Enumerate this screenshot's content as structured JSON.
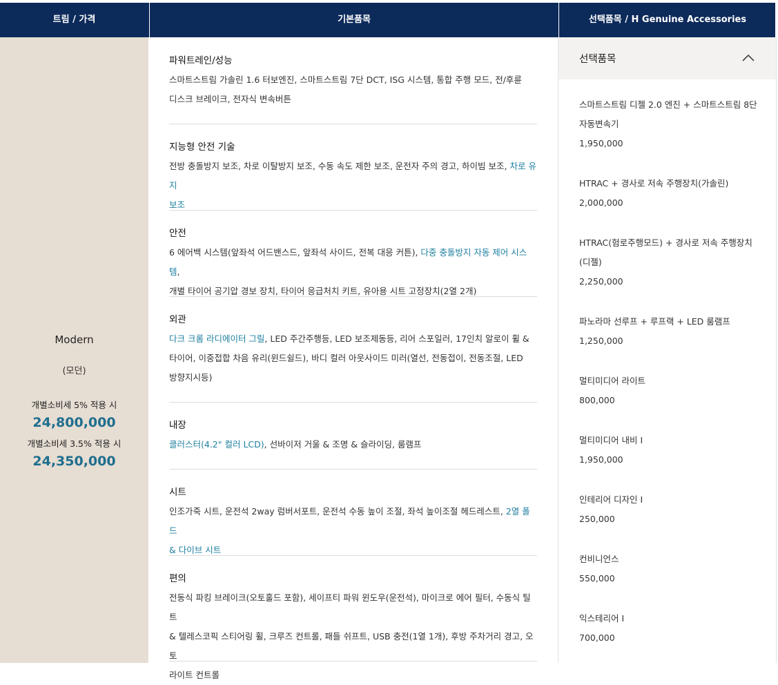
{
  "header": {
    "trim_price": "트림 / 가격",
    "base_items": "기본품목",
    "options": "선택품목 / H Genuine Accessories"
  },
  "trim": {
    "name": "Modern",
    "sub": "(모던)",
    "prices": [
      {
        "label": "개별소비세 5% 적용 시",
        "value": "24,800,000"
      },
      {
        "label": "개별소비세 3.5% 적용 시",
        "value": "24,350,000"
      }
    ]
  },
  "sections": [
    {
      "title": "파워트레인/성능",
      "lines": [
        [
          {
            "t": "스마트스트림 가솔린 1.6 터보엔진, 스마트스트림 7단 DCT, ISG 시스템, 통합 주행 모드, 전/후륜"
          }
        ],
        [
          {
            "t": "디스크 브레이크, 전자식 변속버튼"
          }
        ]
      ]
    },
    {
      "title": "지능형 안전 기술",
      "lines": [
        [
          {
            "t": "전방 충돌방지 보조, 차로 이탈방지 보조, 수동 속도 제한 보조, 운전자 주의 경고, 하이빔 보조, "
          },
          {
            "t": "차로 유지",
            "hl": true
          }
        ],
        [
          {
            "t": "보조",
            "hl": true
          }
        ]
      ]
    },
    {
      "title": "안전",
      "lines": [
        [
          {
            "t": "6 에어백 시스템(앞좌석 어드밴스드, 앞좌석 사이드, 전복 대응 커튼), "
          },
          {
            "t": "다중 충돌방지 자동 제어 시스템",
            "hl": true
          },
          {
            "t": ","
          }
        ],
        [
          {
            "t": "개별 타이어 공기압 경보 장치, 타이어 응급처치 키트, 유아용 시트 고정장치(2열 2개)"
          }
        ]
      ]
    },
    {
      "title": "외관",
      "lines": [
        [
          {
            "t": "다크 크롬 라디에이터 그릴",
            "hl": true
          },
          {
            "t": ", LED 주간주행등, LED 보조제동등, 리어 스포일러, 17인치 알로이 휠 &"
          }
        ],
        [
          {
            "t": "타이어, 이중접합 차음 유리(윈드쉴드), 바디 컬러 아웃사이드 미러(열선, 전동접이, 전동조절, LED"
          }
        ],
        [
          {
            "t": "방향지시등)"
          }
        ]
      ]
    },
    {
      "title": "내장",
      "lines": [
        [
          {
            "t": "클러스터(4.2\" 컬러 LCD)",
            "hl": true
          },
          {
            "t": ", 선바이저 거울 & 조명 & 슬라이딩, 룸램프"
          }
        ]
      ]
    },
    {
      "title": "시트",
      "lines": [
        [
          {
            "t": "인조가죽 시트, 운전석 2way 럼버서포트, 운전석 수동 높이 조절, 좌석 높이조절 헤드레스트, "
          },
          {
            "t": "2열 폴드",
            "hl": true
          }
        ],
        [
          {
            "t": "& 다이브 시트",
            "hl": true
          }
        ]
      ]
    },
    {
      "title": "편의",
      "lines": [
        [
          {
            "t": "전동식 파킹 브레이크(오토홀드 포함), 세이프티 파워 윈도우(운전석), 마이크로 에어 필터, 수동식 틸트"
          }
        ],
        [
          {
            "t": "& 텔레스코픽 스티어링 휠, 크루즈 컨트롤, 패들 쉬프트, USB 충전(1열 1개), 후방 주차거리 경고, 오토"
          }
        ],
        [
          {
            "t": "라이트 컨트롤"
          }
        ]
      ]
    }
  ],
  "options": {
    "title": "선택품목",
    "toggle_icon": "chevron-up-icon",
    "items": [
      {
        "name": [
          "스마트스트림 디젤 2.0 엔진 + 스마트스트림 8단",
          "자동변속기"
        ],
        "price": "1,950,000"
      },
      {
        "name": [
          "HTRAC + 경사로 저속 주행장치(가솔린)"
        ],
        "price": "2,000,000"
      },
      {
        "name": [
          "HTRAC(험로주행모드) + 경사로 저속 주행장치",
          "(디젤)"
        ],
        "price": "2,250,000"
      },
      {
        "name": [
          "파노라마 선루프 + 루프랙 + LED 룸램프"
        ],
        "price": "1,250,000"
      },
      {
        "name": [
          "멀티미디어 라이트"
        ],
        "price": "800,000"
      },
      {
        "name": [
          "멀티미디어 내비 I"
        ],
        "price": "1,950,000"
      },
      {
        "name": [
          "인테리어 디자인 I"
        ],
        "price": "250,000"
      },
      {
        "name": [
          "컨비니언스"
        ],
        "price": "550,000"
      },
      {
        "name": [
          "익스테리어 I"
        ],
        "price": "700,000"
      }
    ]
  },
  "colors": {
    "header_bg": "#0c2a5a",
    "trim_bg": "#e6ddd3",
    "highlight": "#1e7fa0",
    "price": "#1e6e8e"
  }
}
